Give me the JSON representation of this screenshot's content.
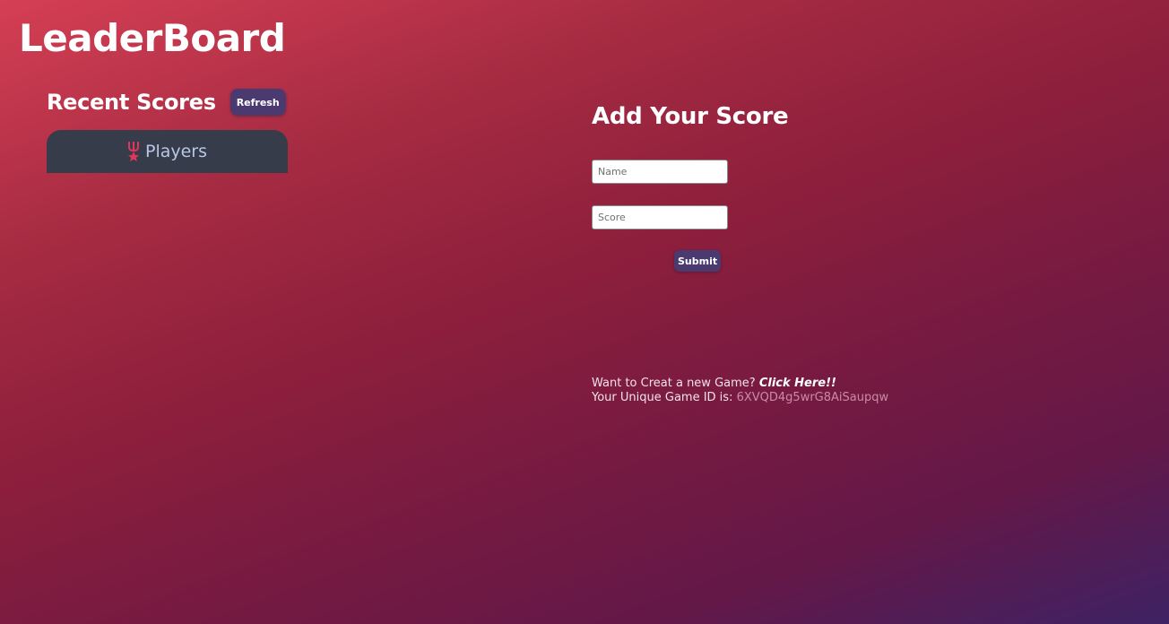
{
  "header": {
    "title": "LeaderBoard"
  },
  "recent_scores": {
    "title": "Recent Scores",
    "refresh_label": "Refresh",
    "table_header": {
      "icon": "medal-icon",
      "label": "Players"
    }
  },
  "add_score": {
    "title": "Add Your Score",
    "name_placeholder": "Name",
    "score_placeholder": "Score",
    "submit_label": "Submit"
  },
  "game_info": {
    "prompt": "Want to Creat a new Game?",
    "link_label": "Click Here!!",
    "id_label": "Your Unique Game ID is:",
    "game_id": "6XVQD4g5wrG8AiSaupqw"
  },
  "colors": {
    "gradient_start": "#d53f54",
    "gradient_end": "#3e2264",
    "button_bg": "#4b3a6f",
    "card_bg": "#363c4a",
    "medal_accent": "#e0365a"
  }
}
